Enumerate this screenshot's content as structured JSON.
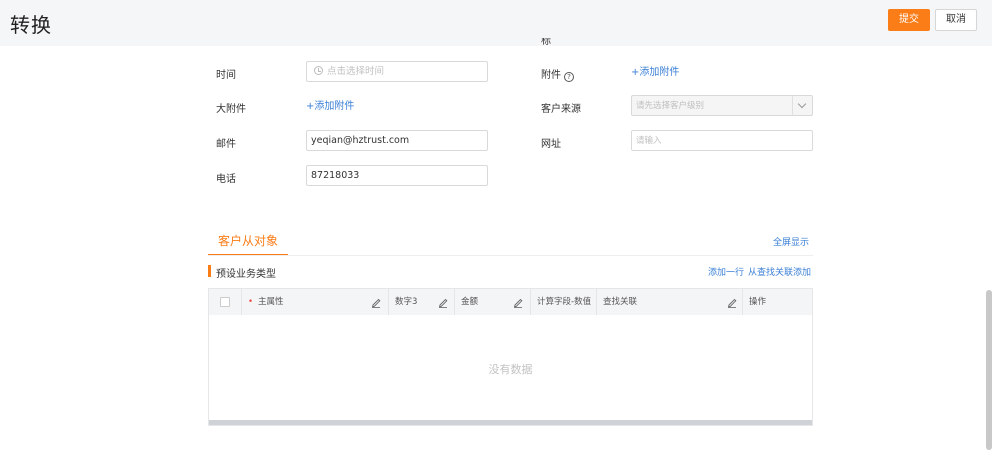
{
  "header": {
    "title": "转换",
    "submit_label": "提交",
    "cancel_label": "取消"
  },
  "form": {
    "cut_label": "标",
    "time": {
      "label": "时间",
      "placeholder": "点击选择时间"
    },
    "attachment": {
      "label": "附件",
      "help": "?",
      "add_link": "+添加附件"
    },
    "big_attachment": {
      "label": "大附件",
      "add_link": "+添加附件"
    },
    "source": {
      "label": "客户来源",
      "placeholder": "请先选择客户级别"
    },
    "email": {
      "label": "邮件",
      "value": "yeqian@hztrust.com"
    },
    "website": {
      "label": "网址",
      "placeholder": "请输入"
    },
    "phone": {
      "label": "电话",
      "value": "87218033"
    }
  },
  "detail": {
    "tab_label": "客户从对象",
    "fullscreen_link": "全屏显示",
    "section_title": "预设业务类型",
    "add_row_link": "添加一行",
    "add_from_lookup_link": "从查找关联添加",
    "columns": {
      "required_mark": "•",
      "main_attr": "主属性",
      "number3": "数字3",
      "amount": "金额",
      "calc_field": "计算字段-数值",
      "lookup": "查找关联",
      "action": "操作"
    },
    "empty_text": "没有数据"
  }
}
